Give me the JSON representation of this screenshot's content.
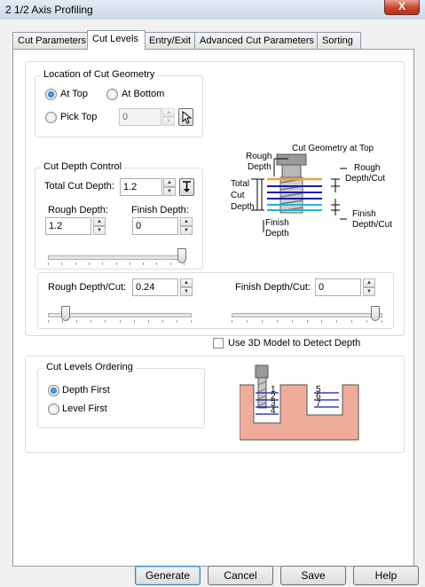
{
  "window": {
    "title": "2 1/2 Axis Profiling",
    "close_label": "X"
  },
  "tabs": [
    {
      "label": "Cut Parameters",
      "active": false
    },
    {
      "label": "Cut Levels",
      "active": true
    },
    {
      "label": "Entry/Exit",
      "active": false
    },
    {
      "label": "Advanced Cut Parameters",
      "active": false
    },
    {
      "label": "Sorting",
      "active": false
    }
  ],
  "location": {
    "title": "Location of Cut Geometry",
    "at_top": "At Top",
    "at_bottom": "At Bottom",
    "pick_top": "Pick Top",
    "pick_top_value": "0",
    "selected": "At Top"
  },
  "depth_control": {
    "title": "Cut Depth Control",
    "total_label": "Total Cut Depth:",
    "total_value": "1.2",
    "rough_label": "Rough Depth:",
    "rough_value": "1.2",
    "finish_label": "Finish Depth:",
    "finish_value": "0",
    "slider_level": 1.0
  },
  "diagram": {
    "cut_geometry_at_top": "Cut Geometry at Top",
    "rough_depth_1": "Rough",
    "rough_depth_2": "Depth",
    "total_1": "Total",
    "total_2": "Cut",
    "total_3": "Depth",
    "finish_depth_1": "Finish",
    "finish_depth_2": "Depth",
    "rough_per_cut_1": "Rough",
    "rough_per_cut_2": "Depth/Cut",
    "finish_per_cut_1": "Finish",
    "finish_per_cut_2": "Depth/Cut"
  },
  "per_cut": {
    "rough_label": "Rough Depth/Cut:",
    "rough_value": "0.24",
    "finish_label": "Finish Depth/Cut:",
    "finish_value": "0",
    "rough_slider_level": 0.1,
    "finish_slider_level": 1.0
  },
  "use_3d_model": {
    "label": "Use 3D Model to Detect Depth",
    "checked": false
  },
  "ordering": {
    "title": "Cut Levels Ordering",
    "depth_first": "Depth First",
    "level_first": "Level First",
    "selected": "Depth First",
    "levels_left": [
      "1",
      "2",
      "3",
      "4"
    ],
    "levels_right": [
      "5",
      "6",
      "7"
    ]
  },
  "buttons": {
    "generate": "Generate",
    "cancel": "Cancel",
    "save": "Save",
    "help": "Help"
  },
  "colors": {
    "material": "#f0ac9a",
    "geometry_line": "#f0a23c",
    "level_line": "#1a1aa8",
    "finish_line": "#1bb8d8"
  }
}
